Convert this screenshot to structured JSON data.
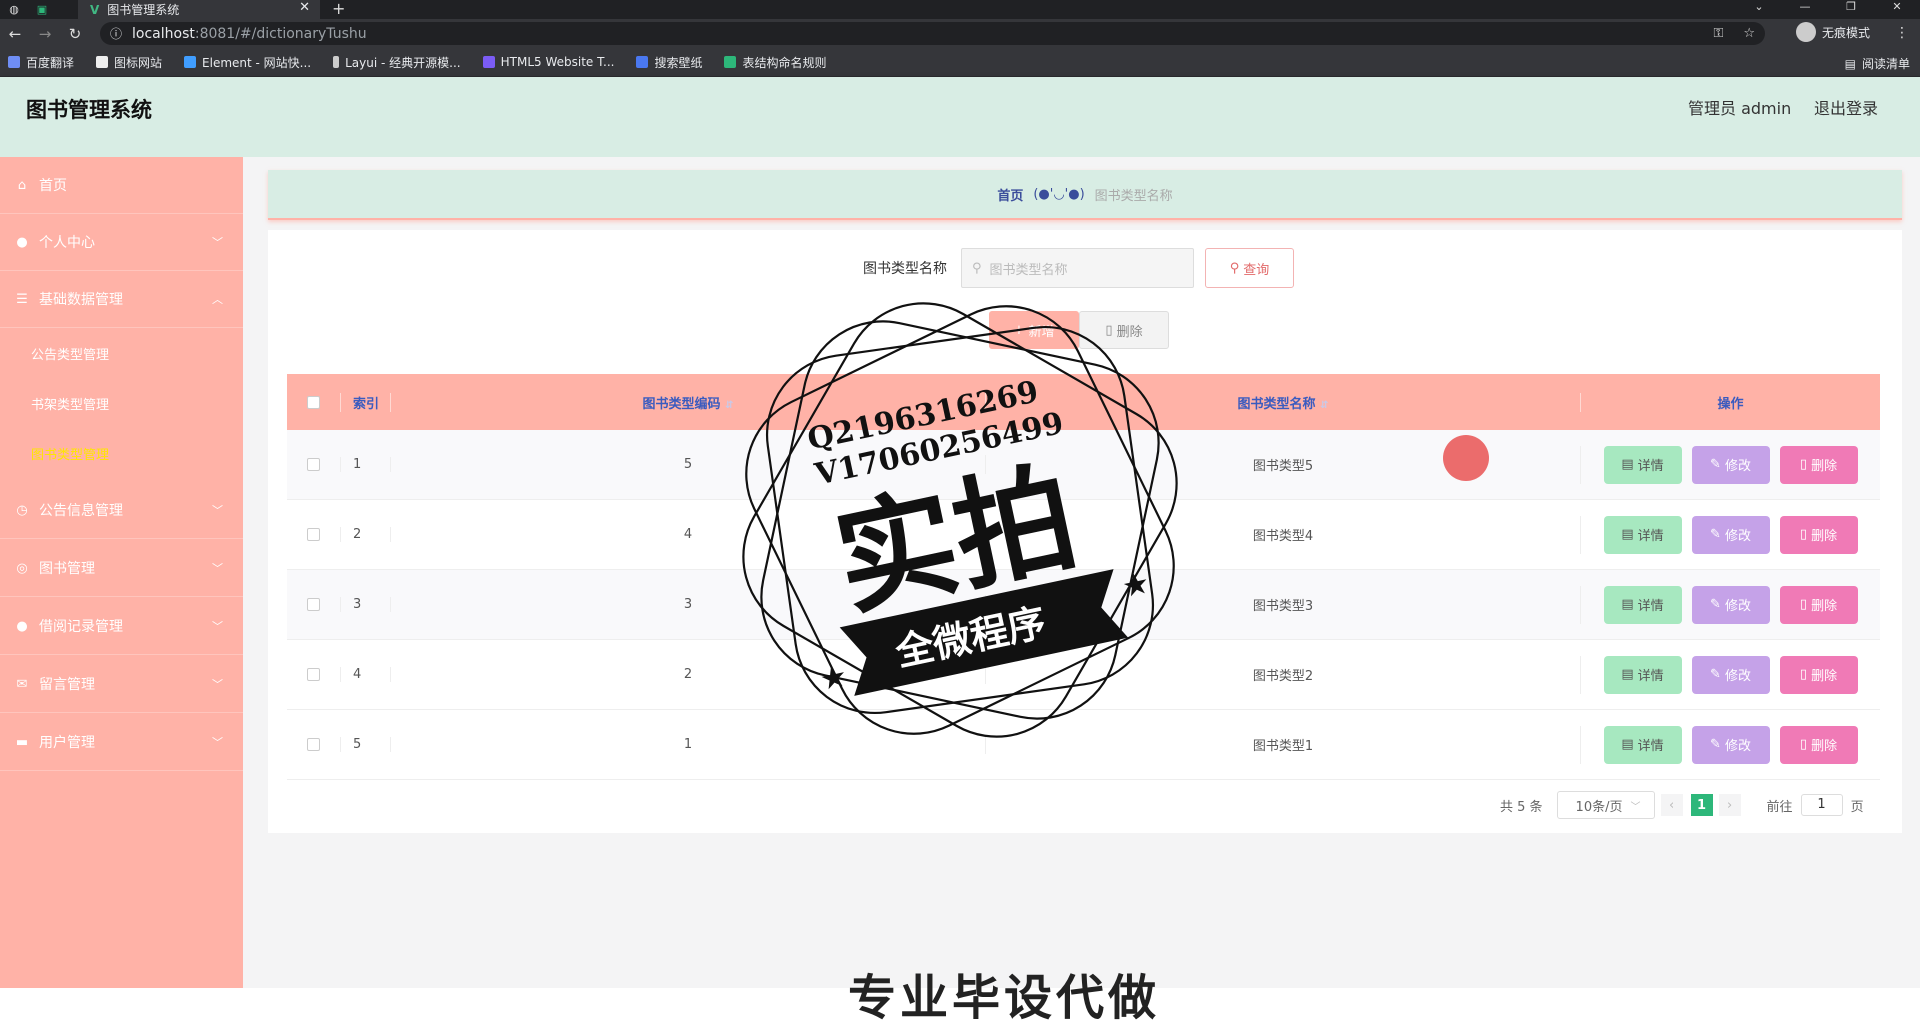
{
  "browser": {
    "tab_title": "图书管理系统",
    "url_host": "localhost",
    "url_path": ":8081/#/dictionaryTushu",
    "incognito_label": "无痕模式",
    "bookmarks": [
      "百度翻译",
      "图标网站",
      "Element - 网站快...",
      "Layui - 经典开源模...",
      "HTML5 Website T...",
      "搜索壁纸",
      "表结构命名规则"
    ],
    "reading_list": "阅读清单"
  },
  "header": {
    "title": "图书管理系统",
    "user": "管理员 admin",
    "logout": "退出登录"
  },
  "sidebar": {
    "items": [
      {
        "label": "首页",
        "icon": "home-icon"
      },
      {
        "label": "个人中心",
        "icon": "user-icon"
      },
      {
        "label": "基础数据管理",
        "icon": "list-icon"
      },
      {
        "label": "公告信息管理",
        "icon": "clock-icon"
      },
      {
        "label": "图书管理",
        "icon": "target-icon"
      },
      {
        "label": "借阅记录管理",
        "icon": "pin-icon"
      },
      {
        "label": "留言管理",
        "icon": "mail-icon"
      },
      {
        "label": "用户管理",
        "icon": "monitor-icon"
      }
    ],
    "sub_items": [
      "公告类型管理",
      "书架类型管理",
      "图书类型管理"
    ]
  },
  "breadcrumb": {
    "home": "首页",
    "face": "(●'◡'●)",
    "current": "图书类型名称"
  },
  "search": {
    "label": "图书类型名称",
    "placeholder": "图书类型名称",
    "button": "查询"
  },
  "actions": {
    "add": "新增",
    "delete": "删除"
  },
  "table": {
    "headers": {
      "index": "索引",
      "code": "图书类型编码",
      "name": "图书类型名称",
      "ops": "操作"
    },
    "rows": [
      {
        "index": "1",
        "code": "5",
        "name": "图书类型5"
      },
      {
        "index": "2",
        "code": "4",
        "name": "图书类型4"
      },
      {
        "index": "3",
        "code": "3",
        "name": "图书类型3"
      },
      {
        "index": "4",
        "code": "2",
        "name": "图书类型2"
      },
      {
        "index": "5",
        "code": "1",
        "name": "图书类型1"
      }
    ],
    "op_labels": {
      "detail": "详情",
      "edit": "修改",
      "delete": "删除"
    }
  },
  "pagination": {
    "total": "共 5 条",
    "size": "10条/页",
    "current": "1",
    "goto_prefix": "前往",
    "goto_value": "1",
    "goto_suffix": "页"
  },
  "watermark": {
    "line1": "Q2196316269",
    "line2": "V17060256499",
    "big": "实拍",
    "banner": "全微程序"
  },
  "footer_text": "专业毕设代做",
  "colors": {
    "accent": "#ffb2a7",
    "header_bg": "#d8ede4",
    "active_sub": "#ffe600"
  }
}
